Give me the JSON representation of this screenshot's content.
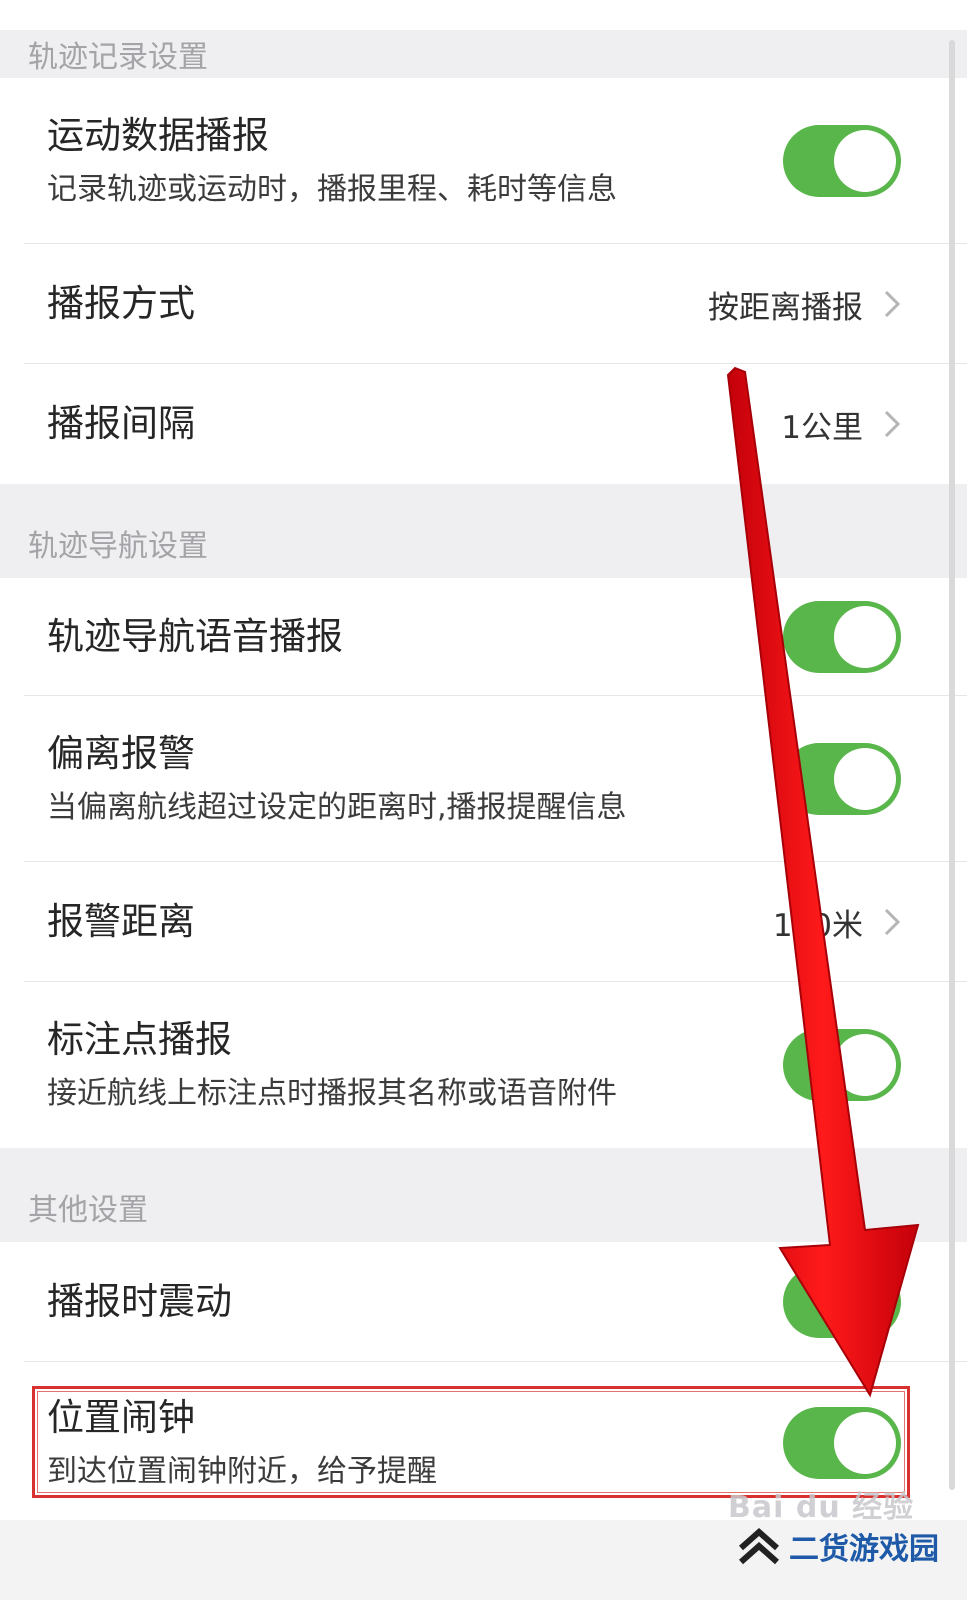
{
  "sections": [
    {
      "header": "轨迹记录设置",
      "rows": [
        {
          "title": "运动数据播报",
          "subtitle": "记录轨迹或运动时，播报里程、耗时等信息",
          "toggle": true
        },
        {
          "title": "播报方式",
          "value": "按距离播报"
        },
        {
          "title": "播报间隔",
          "value": "1公里"
        }
      ]
    },
    {
      "header": "轨迹导航设置",
      "rows": [
        {
          "title": "轨迹导航语音播报",
          "toggle": true
        },
        {
          "title": "偏离报警",
          "subtitle": "当偏离航线超过设定的距离时,播报提醒信息",
          "toggle": true
        },
        {
          "title": "报警距离",
          "value": "100米"
        },
        {
          "title": "标注点播报",
          "subtitle": "接近航线上标注点时播报其名称或语音附件",
          "toggle": true
        }
      ]
    },
    {
      "header": "其他设置",
      "rows": [
        {
          "title": "播报时震动",
          "toggle": true
        },
        {
          "title": "位置闹钟",
          "subtitle": "到达位置闹钟附近，给予提醒",
          "toggle": true
        }
      ]
    }
  ],
  "watermarks": {
    "baidu": "Bai du 经验",
    "site": "二货游戏园"
  },
  "colors": {
    "toggle_on": "#59b64a",
    "section_bg": "#efeff1",
    "arrow": "#e8000d",
    "highlight": "#d93030"
  }
}
